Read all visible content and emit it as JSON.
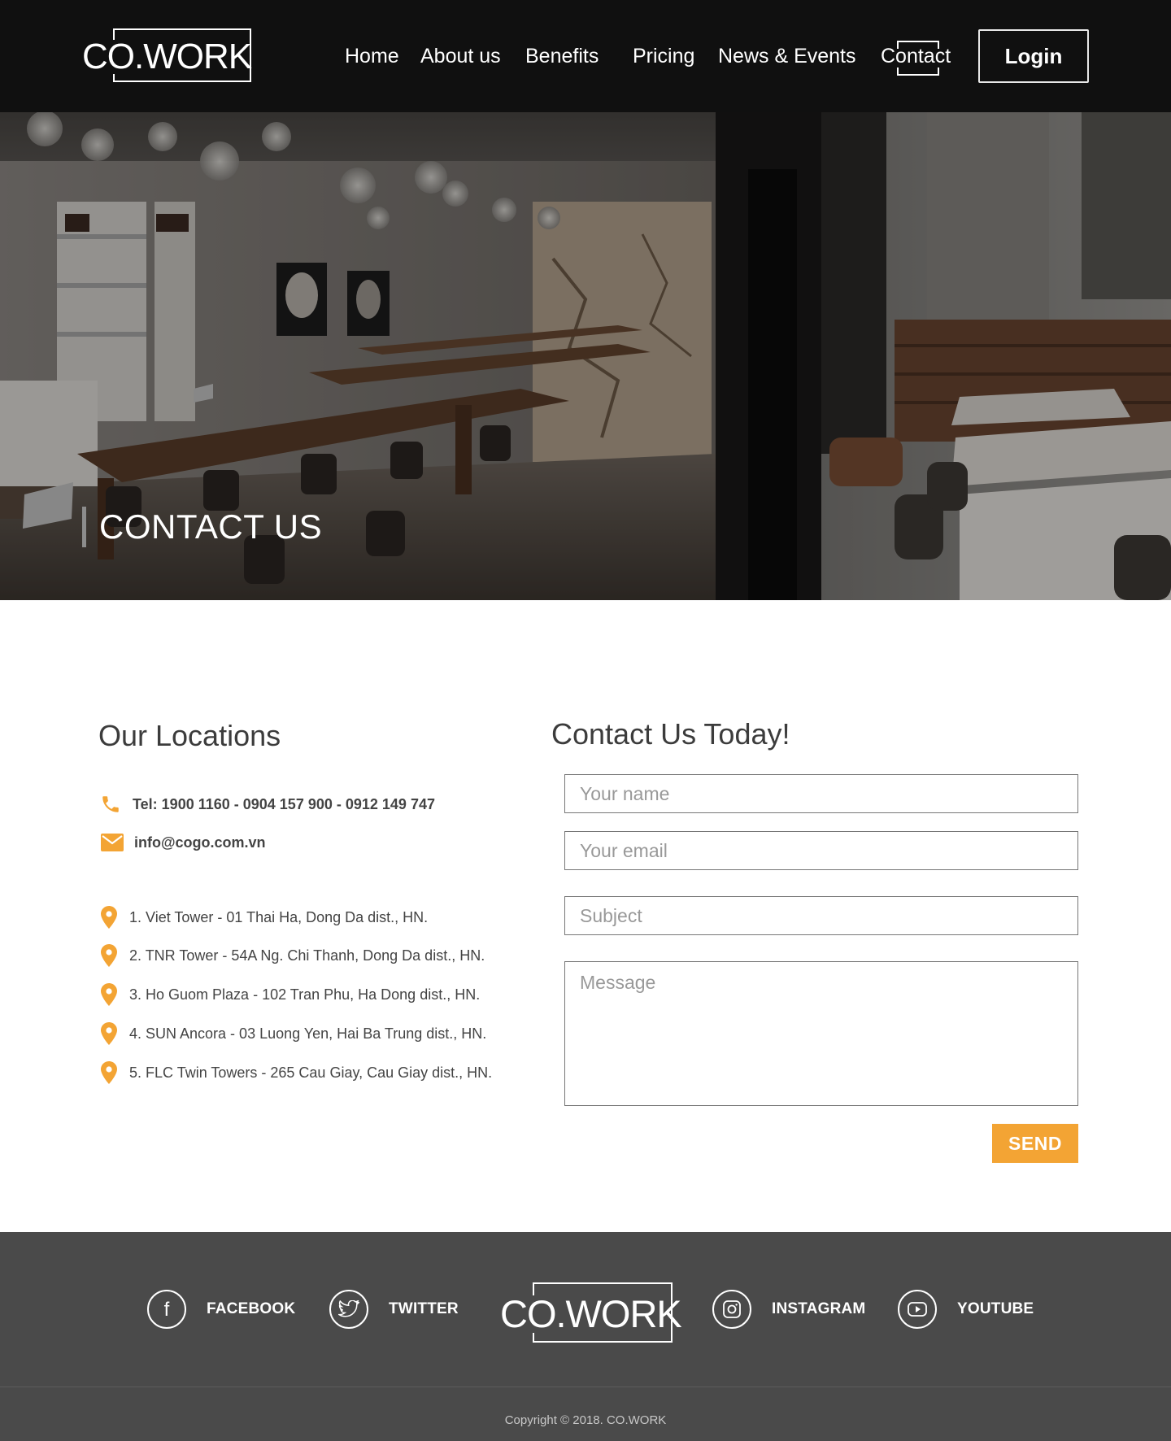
{
  "header": {
    "logo": "CO.WORK",
    "nav": [
      "Home",
      "About us",
      "Benefits",
      "Pricing",
      "News & Events",
      "Contact"
    ],
    "active_nav": "Contact",
    "login_label": "Login"
  },
  "hero": {
    "title": "CONTACT US"
  },
  "locations": {
    "title": "Our Locations",
    "tel": "Tel: 1900 1160 - 0904 157 900 - 0912 149 747",
    "email": "info@cogo.com.vn",
    "items": [
      "1. Viet Tower - 01 Thai Ha, Dong Da dist., HN.",
      "2. TNR Tower - 54A Ng. Chi Thanh, Dong Da dist., HN.",
      "3. Ho Guom Plaza - 102 Tran Phu, Ha Dong dist., HN.",
      "4. SUN Ancora - 03 Luong Yen, Hai Ba Trung dist., HN.",
      "5. FLC Twin Towers - 265 Cau Giay, Cau Giay dist., HN."
    ]
  },
  "form": {
    "title": "Contact Us Today!",
    "name_placeholder": "Your name",
    "email_placeholder": "Your email",
    "subject_placeholder": "Subject",
    "message_placeholder": "Message",
    "send_label": "SEND"
  },
  "footer": {
    "social": [
      "FACEBOOK",
      "TWITTER",
      "INSTAGRAM",
      "YOUTUBE"
    ],
    "logo": "CO.WORK",
    "copyright": "Copyright © 2018. CO.WORK"
  },
  "colors": {
    "accent": "#f3a434",
    "header_bg": "#101010",
    "footer_bg": "#4a4a4a"
  }
}
